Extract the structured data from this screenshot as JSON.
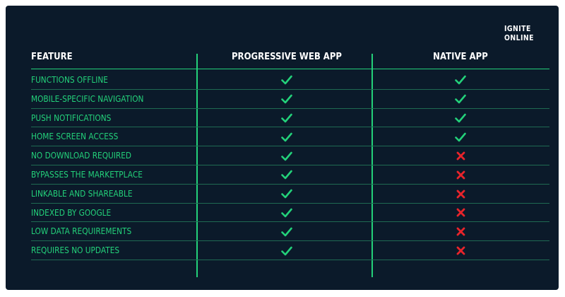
{
  "colors": {
    "background": "#0b1a2a",
    "accent_green": "#23d17a",
    "header_text": "#ffffff",
    "cross_red": "#e8242b"
  },
  "logo": {
    "line1": "IGNITE",
    "line2": "ONLINE"
  },
  "table": {
    "headers": [
      "FEATURE",
      "PROGRESSIVE WEB APP",
      "NATIVE APP"
    ],
    "rows": [
      {
        "feature": "FUNCTIONS OFFLINE",
        "pwa": "check-icon",
        "native": "check-icon"
      },
      {
        "feature": "MOBILE-SPECIFIC NAVIGATION",
        "pwa": "check-icon",
        "native": "check-icon"
      },
      {
        "feature": "PUSH NOTIFICATIONS",
        "pwa": "check-icon",
        "native": "check-icon"
      },
      {
        "feature": "HOME SCREEN ACCESS",
        "pwa": "check-icon",
        "native": "check-icon"
      },
      {
        "feature": "NO DOWNLOAD REQUIRED",
        "pwa": "check-icon",
        "native": "cross-icon"
      },
      {
        "feature": "BYPASSES THE MARKETPLACE",
        "pwa": "check-icon",
        "native": "cross-icon"
      },
      {
        "feature": "LINKABLE AND SHAREABLE",
        "pwa": "check-icon",
        "native": "cross-icon"
      },
      {
        "feature": "INDEXED BY GOOGLE",
        "pwa": "check-icon",
        "native": "cross-icon"
      },
      {
        "feature": "LOW DATA REQUIREMENTS",
        "pwa": "check-icon",
        "native": "cross-icon"
      },
      {
        "feature": "REQUIRES NO UPDATES",
        "pwa": "check-icon",
        "native": "cross-icon"
      }
    ]
  }
}
